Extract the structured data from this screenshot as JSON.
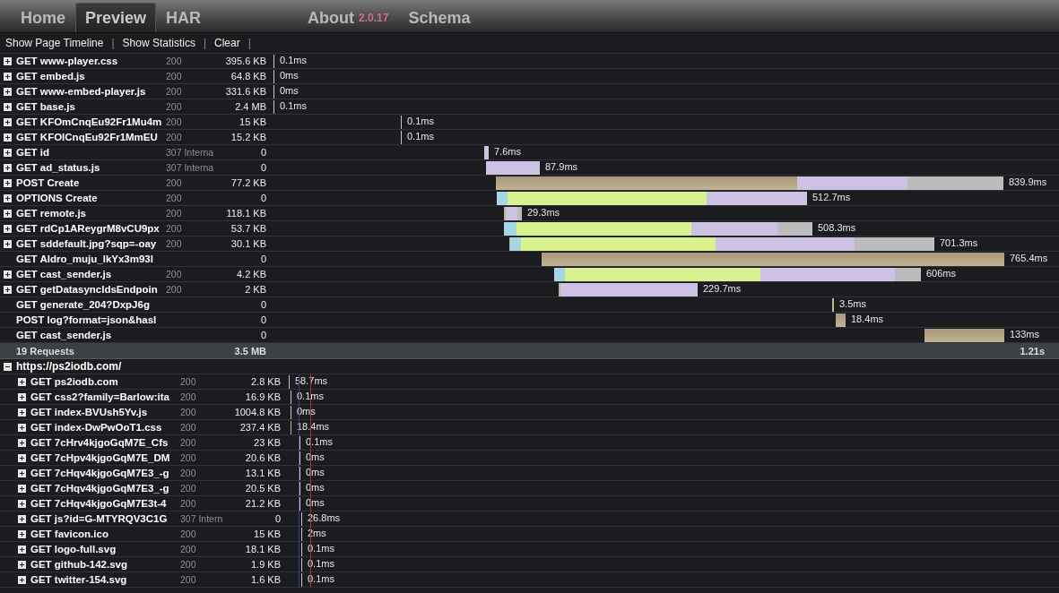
{
  "tabs": [
    {
      "label": "Home",
      "selected": false
    },
    {
      "label": "Preview",
      "selected": true
    },
    {
      "label": "HAR",
      "selected": false
    }
  ],
  "right_tabs": [
    {
      "label": "About",
      "version": "2.0.17"
    },
    {
      "label": "Schema"
    }
  ],
  "toolbar": {
    "links": [
      "Show Page Timeline",
      "Show Statistics",
      "Clear"
    ],
    "separator": "|"
  },
  "pages": [
    {
      "requests": [
        {
          "name": "GET www-player.css",
          "status": "200",
          "size": "395.6 KB",
          "time": "0.1ms",
          "expandable": true
        },
        {
          "name": "GET embed.js",
          "status": "200",
          "size": "64.8 KB",
          "time": "0ms",
          "expandable": true
        },
        {
          "name": "GET www-embed-player.js",
          "status": "200",
          "size": "331.6 KB",
          "time": "0ms",
          "expandable": true
        },
        {
          "name": "GET base.js",
          "status": "200",
          "size": "2.4 MB",
          "time": "0.1ms",
          "expandable": true
        },
        {
          "name": "GET KFOmCnqEu92Fr1Mu4m",
          "status": "200",
          "size": "15 KB",
          "time": "0.1ms",
          "expandable": true
        },
        {
          "name": "GET KFOlCnqEu92Fr1MmEU",
          "status": "200",
          "size": "15.2 KB",
          "time": "0.1ms",
          "expandable": true
        },
        {
          "name": "GET id",
          "status": "307 Interna",
          "size": "0",
          "time": "7.6ms",
          "expandable": true
        },
        {
          "name": "GET ad_status.js",
          "status": "307 Interna",
          "size": "0",
          "time": "87.9ms",
          "expandable": true
        },
        {
          "name": "POST Create",
          "status": "200",
          "size": "77.2 KB",
          "time": "839.9ms",
          "expandable": true
        },
        {
          "name": "OPTIONS Create",
          "status": "200",
          "size": "0",
          "time": "512.7ms",
          "expandable": true
        },
        {
          "name": "GET remote.js",
          "status": "200",
          "size": "118.1 KB",
          "time": "29.3ms",
          "expandable": true
        },
        {
          "name": "GET rdCp1AReygrM8vCU9px",
          "status": "200",
          "size": "53.7 KB",
          "time": "508.3ms",
          "expandable": true
        },
        {
          "name": "GET sddefault.jpg?sqp=-oay",
          "status": "200",
          "size": "30.1 KB",
          "time": "701.3ms",
          "expandable": true
        },
        {
          "name": "GET AIdro_muju_lkYx3m93l",
          "size": "0",
          "time": "765.4ms",
          "expandable": false
        },
        {
          "name": "GET cast_sender.js",
          "status": "200",
          "size": "4.2 KB",
          "time": "606ms",
          "expandable": true
        },
        {
          "name": "GET getDatasyncIdsEndpoin",
          "status": "200",
          "size": "2 KB",
          "time": "229.7ms",
          "expandable": true
        },
        {
          "name": "GET generate_204?DxpJ6g",
          "size": "0",
          "time": "3.5ms",
          "expandable": false
        },
        {
          "name": "POST log?format=json&hasl",
          "size": "0",
          "time": "18.4ms",
          "expandable": false
        },
        {
          "name": "GET cast_sender.js",
          "size": "0",
          "time": "133ms",
          "expandable": false
        }
      ],
      "summary": {
        "count": "19 Requests",
        "size": "3.5 MB",
        "time": "1.21s"
      }
    },
    {
      "url": "https://ps2iodb.com/",
      "expanded": true,
      "requests": [
        {
          "name": "GET ps2iodb.com",
          "status": "200",
          "size": "2.8 KB",
          "time": "58.7ms",
          "expandable": true
        },
        {
          "name": "GET css2?family=Barlow:ita",
          "status": "200",
          "size": "16.9 KB",
          "time": "0.1ms",
          "expandable": true
        },
        {
          "name": "GET index-BVUsh5Yv.js",
          "status": "200",
          "size": "1004.8 KB",
          "time": "0ms",
          "expandable": true
        },
        {
          "name": "GET index-DwPwOoT1.css",
          "status": "200",
          "size": "237.4 KB",
          "time": "18.4ms",
          "expandable": true
        },
        {
          "name": "GET 7cHrv4kjgoGqM7E_Cfs",
          "status": "200",
          "size": "23 KB",
          "time": "0.1ms",
          "expandable": true
        },
        {
          "name": "GET 7cHpv4kjgoGqM7E_DM",
          "status": "200",
          "size": "20.6 KB",
          "time": "0ms",
          "expandable": true
        },
        {
          "name": "GET 7cHqv4kjgoGqM7E3_-g",
          "status": "200",
          "size": "13.1 KB",
          "time": "0ms",
          "expandable": true
        },
        {
          "name": "GET 7cHqv4kjgoGqM7E3_-g",
          "status": "200",
          "size": "20.5 KB",
          "time": "0ms",
          "expandable": true
        },
        {
          "name": "GET 7cHqv4kjgoGqM7E3t-4",
          "status": "200",
          "size": "21.2 KB",
          "time": "0ms",
          "expandable": true
        },
        {
          "name": "GET js?id=G-MTYRQV3C1G",
          "status": "307 Intern",
          "size": "0",
          "time": "26.8ms",
          "expandable": true
        },
        {
          "name": "GET favicon.ico",
          "status": "200",
          "size": "15 KB",
          "time": "2ms",
          "expandable": true
        },
        {
          "name": "GET logo-full.svg",
          "status": "200",
          "size": "18.1 KB",
          "time": "0.1ms",
          "expandable": true
        },
        {
          "name": "GET github-142.svg",
          "status": "200",
          "size": "1.9 KB",
          "time": "0.1ms",
          "expandable": true
        },
        {
          "name": "GET twitter-154.svg",
          "status": "200",
          "size": "1.6 KB",
          "time": "0.1ms",
          "expandable": true
        }
      ]
    }
  ]
}
